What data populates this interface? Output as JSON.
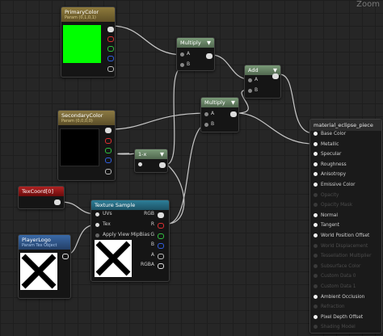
{
  "zoom_label": "Zoom",
  "nodes": {
    "primary_color": {
      "title": "PrimaryColor",
      "subtitle": "Param (0,1,0,1)",
      "swatch_color": "#00ff00"
    },
    "secondary_color": {
      "title": "SecondaryColor",
      "subtitle": "Param (0,0,0,0)",
      "swatch_color": "#000000"
    },
    "multiply_1": {
      "title": "Multiply",
      "pin_a": "A",
      "pin_b": "B"
    },
    "multiply_2": {
      "title": "Multiply",
      "pin_a": "A",
      "pin_b": "B"
    },
    "add": {
      "title": "Add",
      "pin_a": "A",
      "pin_b": "B"
    },
    "one_minus": {
      "title": "1-x"
    },
    "tex_coord": {
      "title": "TexCoord[0]"
    },
    "texture_sample": {
      "title": "Texture Sample",
      "inputs": [
        "UVs",
        "Tex",
        "Apply View MipBias"
      ],
      "outputs": [
        "RGB",
        "R",
        "G",
        "B",
        "A",
        "RGBA"
      ]
    },
    "player_logo": {
      "title": "PlayerLogo",
      "subtitle": "Param Tex Object"
    }
  },
  "material_output": {
    "title": "material_eclipse_piece",
    "pins": [
      {
        "label": "Base Color",
        "active": true
      },
      {
        "label": "Metallic",
        "active": true
      },
      {
        "label": "Specular",
        "active": true
      },
      {
        "label": "Roughness",
        "active": true
      },
      {
        "label": "Anisotropy",
        "active": true
      },
      {
        "label": "Emissive Color",
        "active": true
      },
      {
        "label": "Opacity",
        "active": false
      },
      {
        "label": "Opacity Mask",
        "active": false
      },
      {
        "label": "Normal",
        "active": true
      },
      {
        "label": "Tangent",
        "active": true
      },
      {
        "label": "World Position Offset",
        "active": true
      },
      {
        "label": "World Displacement",
        "active": false
      },
      {
        "label": "Tessellation Multiplier",
        "active": false
      },
      {
        "label": "Subsurface Color",
        "active": false
      },
      {
        "label": "Custom Data 0",
        "active": false
      },
      {
        "label": "Custom Data 1",
        "active": false
      },
      {
        "label": "Ambient Occlusion",
        "active": true
      },
      {
        "label": "Refraction",
        "active": false
      },
      {
        "label": "Pixel Depth Offset",
        "active": true
      },
      {
        "label": "Shading Model",
        "active": false
      }
    ]
  }
}
